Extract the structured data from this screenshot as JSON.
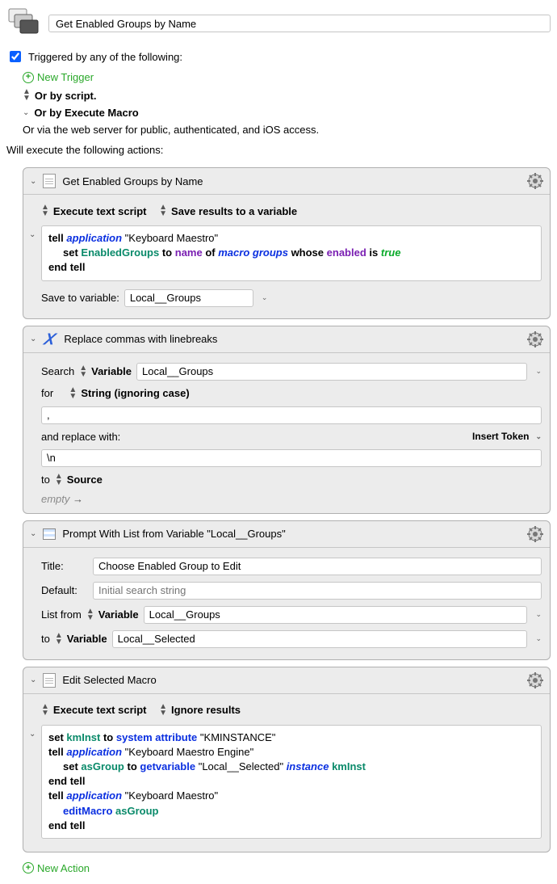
{
  "title": "Get Enabled Groups by Name",
  "triggered_label": "Triggered by any of the following:",
  "new_trigger": "New Trigger",
  "or_script": "Or by script.",
  "or_macro": "Or by Execute Macro",
  "web_server": "Or via the web server for public, authenticated, and iOS access.",
  "will_execute": "Will execute the following actions:",
  "new_action": "New Action",
  "insert_token": "Insert Token",
  "action1": {
    "title": "Get Enabled Groups by Name",
    "opt1": "Execute text script",
    "opt2": "Save results to a variable",
    "save_to": "Save to variable:",
    "save_var": "Local__Groups",
    "code": {
      "l1_tell": "tell",
      "l1_app": "application",
      "l1_str": "\"Keyboard Maestro\"",
      "l2_set": "set",
      "l2_var": "EnabledGroups",
      "l2_to": "to",
      "l2_name": "name",
      "l2_of": "of",
      "l2_mg": "macro groups",
      "l2_whose": "whose",
      "l2_en": "enabled",
      "l2_is": "is",
      "l2_true": "true",
      "l3": "end tell"
    }
  },
  "action2": {
    "title": "Replace commas with linebreaks",
    "search": "Search",
    "variable": "Variable",
    "search_var": "Local__Groups",
    "for": "for",
    "for_opt": "String (ignoring case)",
    "for_val": ",",
    "replace_with": "and replace with:",
    "replace_val": "\\n",
    "to": "to",
    "to_opt": "Source",
    "empty": "empty",
    "arrow": "→"
  },
  "action3": {
    "title": "Prompt With List from Variable \"Local__Groups\"",
    "title_lbl": "Title:",
    "title_val": "Choose Enabled Group to Edit",
    "default_lbl": "Default:",
    "default_ph": "Initial search string",
    "list_from": "List from",
    "variable": "Variable",
    "list_var": "Local__Groups",
    "to": "to",
    "to_variable": "Variable",
    "to_var": "Local__Selected"
  },
  "action4": {
    "title": "Edit Selected Macro",
    "opt1": "Execute text script",
    "opt2": "Ignore results",
    "code": {
      "l1_set": "set",
      "l1_var": "kmInst",
      "l1_to": "to",
      "l1_sys": "system attribute",
      "l1_str": "\"KMINSTANCE\"",
      "l2_tell": "tell",
      "l2_app": "application",
      "l2_str": "\"Keyboard Maestro Engine\"",
      "l3_set": "set",
      "l3_var": "asGroup",
      "l3_to": "to",
      "l3_gv": "getvariable",
      "l3_str": "\"Local__Selected\"",
      "l3_inst": "instance",
      "l3_km": "kmInst",
      "l4": "end tell",
      "l5_tell": "tell",
      "l5_app": "application",
      "l5_str": "\"Keyboard Maestro\"",
      "l6_em": "editMacro",
      "l6_var": "asGroup",
      "l7": "end tell"
    }
  }
}
